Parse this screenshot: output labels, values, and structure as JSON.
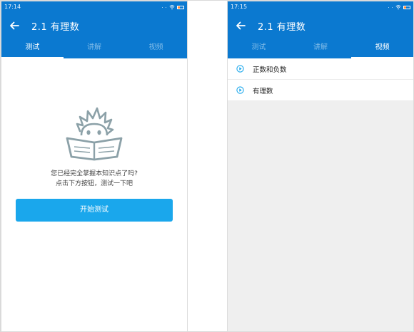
{
  "colors": {
    "primary": "#0b79d0",
    "button": "#1aa7ec",
    "play_icon": "#1aa7ec",
    "mascot": "#8ca1a8",
    "battery": "#ff8a3a"
  },
  "left_screen": {
    "status_time": "17:14",
    "title": "2.1 有理数",
    "tabs": [
      {
        "label": "测试",
        "active": true
      },
      {
        "label": "讲解",
        "active": false
      },
      {
        "label": "视频",
        "active": false
      }
    ],
    "empty_state": {
      "icon": "mascot-reading-book-icon",
      "line1": "您已经完全掌握本知识点了吗?",
      "line2": "点击下方按钮，测试一下吧"
    },
    "start_button": "开始测试"
  },
  "right_screen": {
    "status_time": "17:15",
    "title": "2.1 有理数",
    "tabs": [
      {
        "label": "测试",
        "active": false
      },
      {
        "label": "讲解",
        "active": false
      },
      {
        "label": "视频",
        "active": true
      }
    ],
    "videos": [
      {
        "title": "正数和负数",
        "icon": "play-icon"
      },
      {
        "title": "有理数",
        "icon": "play-icon"
      }
    ]
  }
}
